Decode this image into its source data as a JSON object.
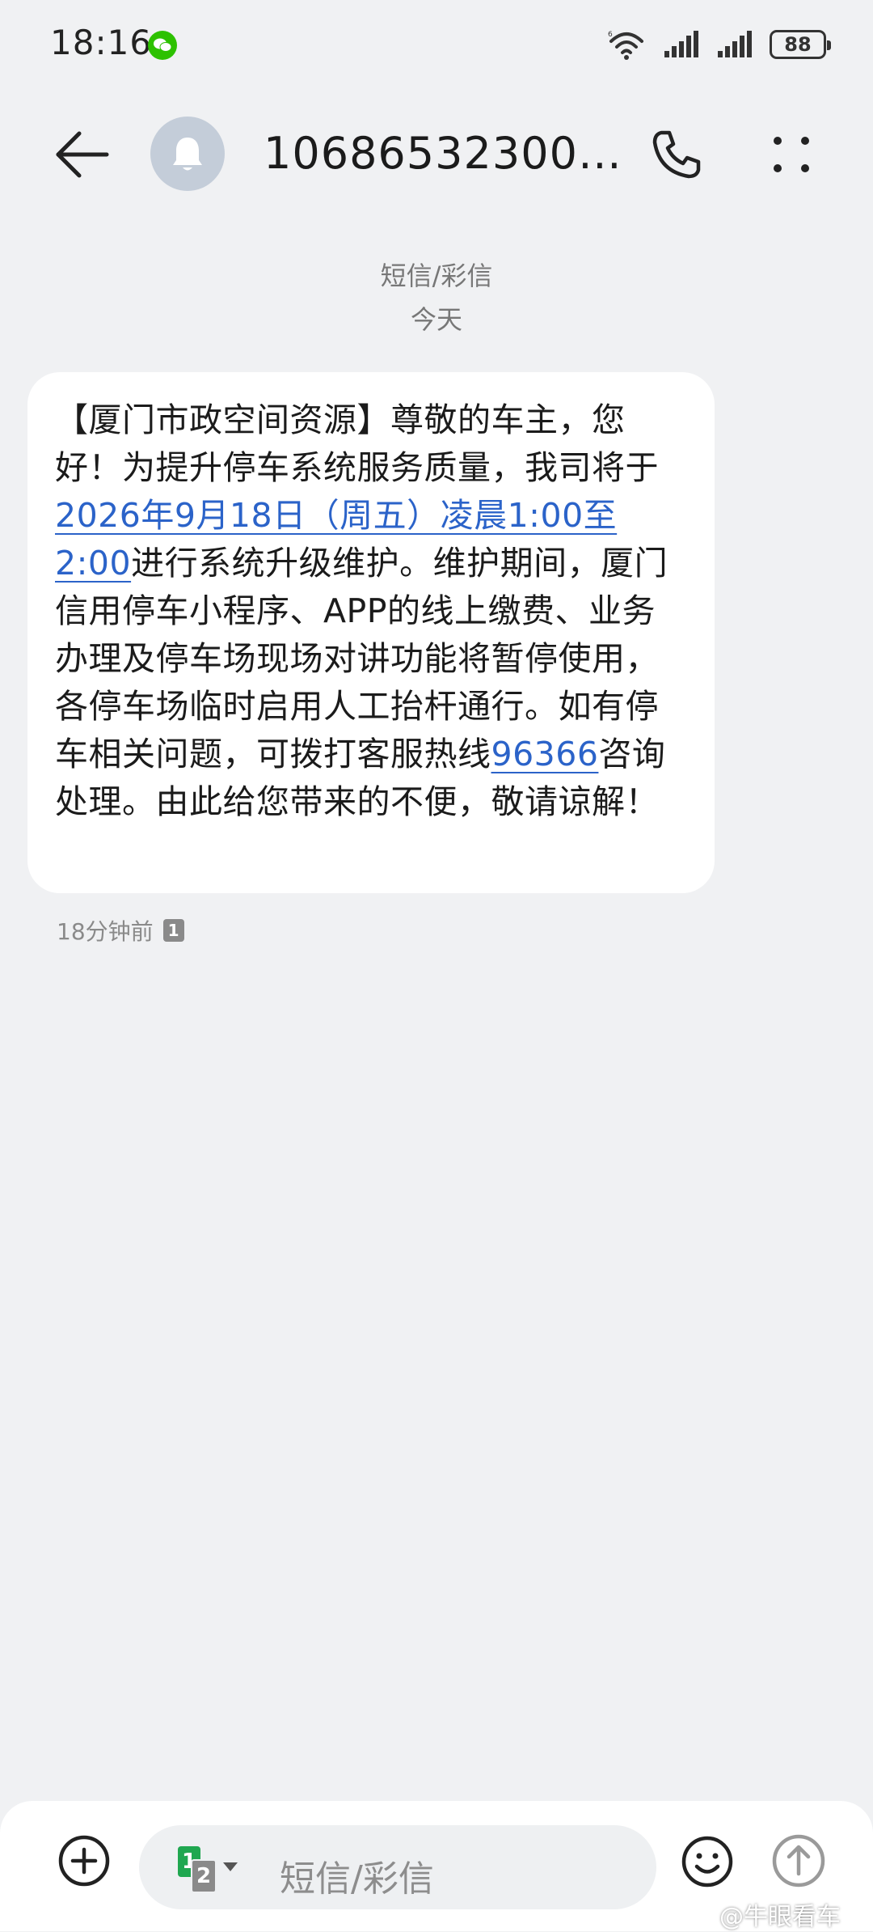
{
  "status_bar": {
    "time": "18:16",
    "battery": "88",
    "icons": [
      "wechat-icon",
      "wifi-icon",
      "signal-icon",
      "signal-icon",
      "battery-icon"
    ]
  },
  "header": {
    "contact_name": "10686532300…",
    "icons": [
      "back-arrow-icon",
      "bell-icon",
      "phone-icon",
      "more-icon"
    ]
  },
  "conversation": {
    "type_label": "短信/彩信",
    "date_label": "今天"
  },
  "message": {
    "parts": [
      {
        "text": "【厦门市政空间资源】尊敬的车主，您好！为提升停车系统服务质量，我司将于",
        "link": false
      },
      {
        "text": "2026年9月18日（周五）凌晨1:00至2:00",
        "link": true
      },
      {
        "text": "进行系统升级维护。维护期间，厦门信用停车小程序、APP的线上缴费、业务办理及停车场现场对讲功能将暂停使用，各停车场临时启用人工抬杆通行。如有停车相关问题，可拨打客服热线",
        "link": false
      },
      {
        "text": "96366",
        "link": true
      },
      {
        "text": "咨询处理。由此给您带来的不便，敬请谅解！",
        "link": false
      }
    ],
    "time_ago": "18分钟前",
    "sim": "1"
  },
  "composer": {
    "placeholder": "短信/彩信",
    "sim_primary": "1",
    "sim_secondary": "2",
    "icons": [
      "add-icon",
      "sim-switch-icon",
      "emoji-icon",
      "send-icon"
    ]
  },
  "watermark": "@牛眼看车",
  "colors": {
    "link": "#2b63c9",
    "background": "#f0f1f3",
    "bubble": "#ffffff",
    "sim_green": "#1fa750"
  }
}
